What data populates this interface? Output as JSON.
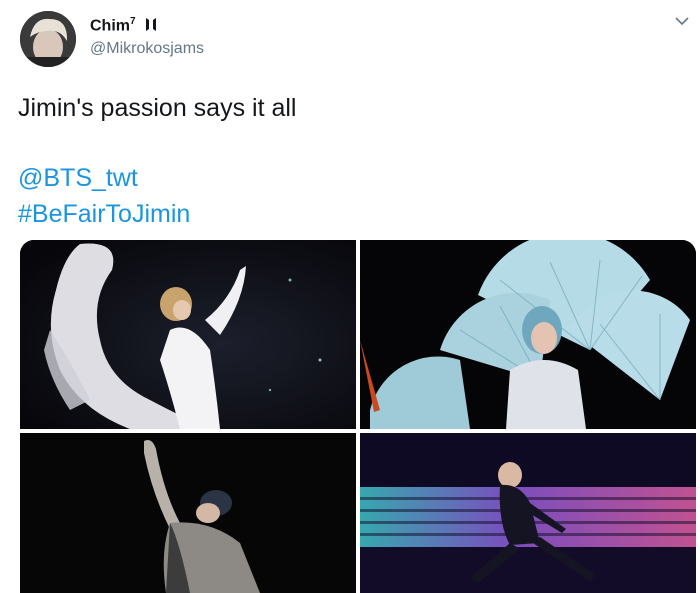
{
  "tweet": {
    "display_name": "Chim",
    "name_superscript": "7",
    "handle": "@Mikrokosjams",
    "text": "Jimin's passion says it all",
    "mention": "@BTS_twt",
    "hashtag": "#BeFairToJimin"
  },
  "icons": {
    "badge": "bts-logo-icon",
    "menu": "chevron-down-icon"
  },
  "colors": {
    "link": "#1b95e0",
    "text": "#14171a",
    "secondary": "#657786"
  }
}
